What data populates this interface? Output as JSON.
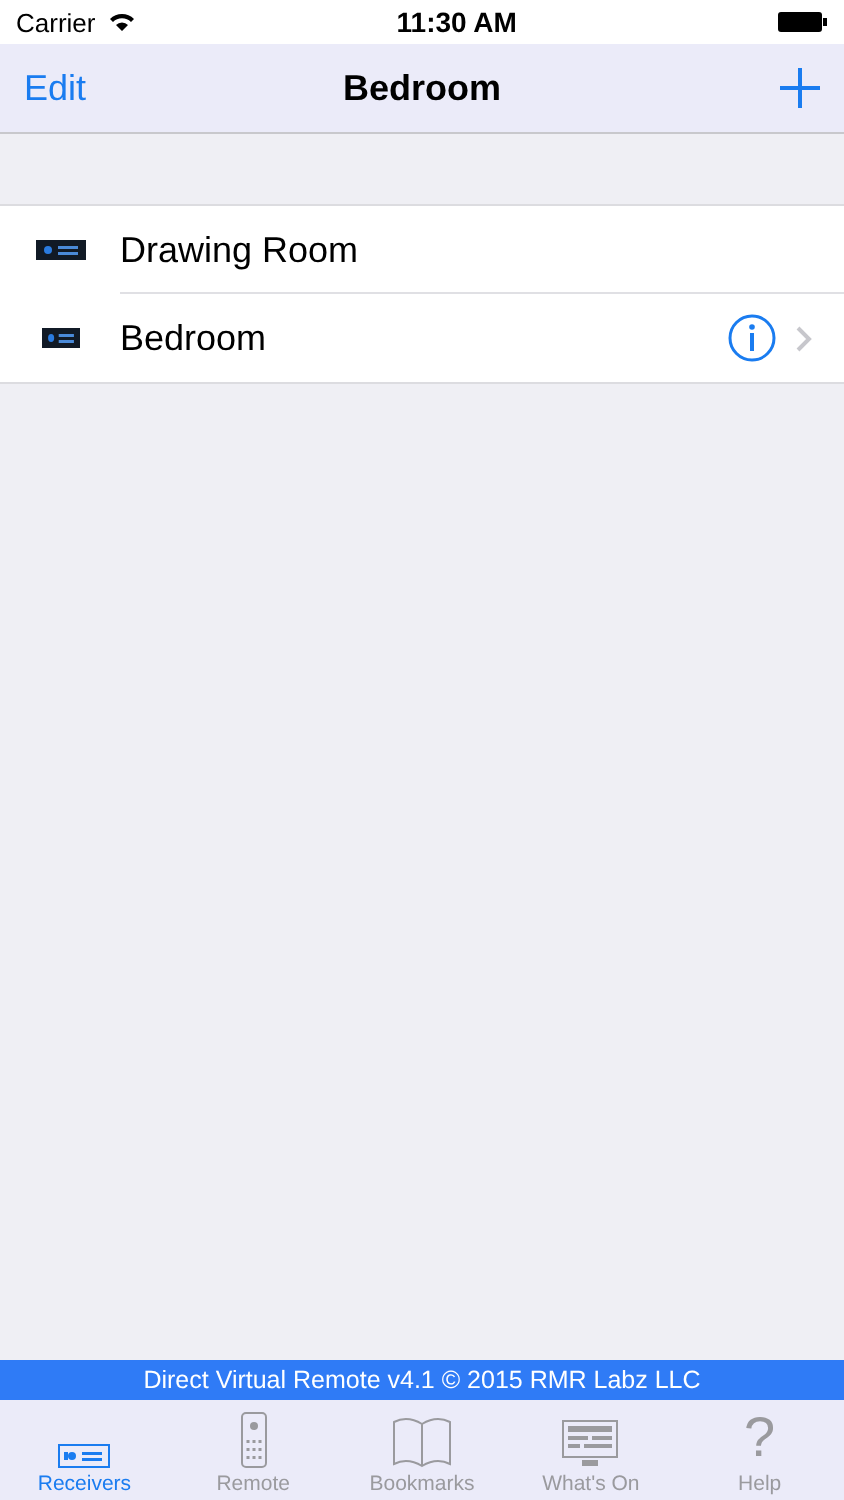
{
  "status_bar": {
    "carrier": "Carrier",
    "time": "11:30 AM"
  },
  "nav": {
    "left": "Edit",
    "title": "Bedroom"
  },
  "receivers": [
    {
      "name": "Drawing Room",
      "kind": "large",
      "info": false
    },
    {
      "name": "Bedroom",
      "kind": "small",
      "info": true
    }
  ],
  "footer": "Direct Virtual Remote v4.1 © 2015 RMR Labz LLC",
  "tabs": [
    {
      "label": "Receivers",
      "kind": "receiver",
      "selected": true
    },
    {
      "label": "Remote",
      "kind": "remote",
      "selected": false
    },
    {
      "label": "Bookmarks",
      "kind": "book",
      "selected": false
    },
    {
      "label": "What's On",
      "kind": "guide",
      "selected": false
    },
    {
      "label": "Help",
      "kind": "help",
      "glyph": "?",
      "selected": false
    }
  ]
}
